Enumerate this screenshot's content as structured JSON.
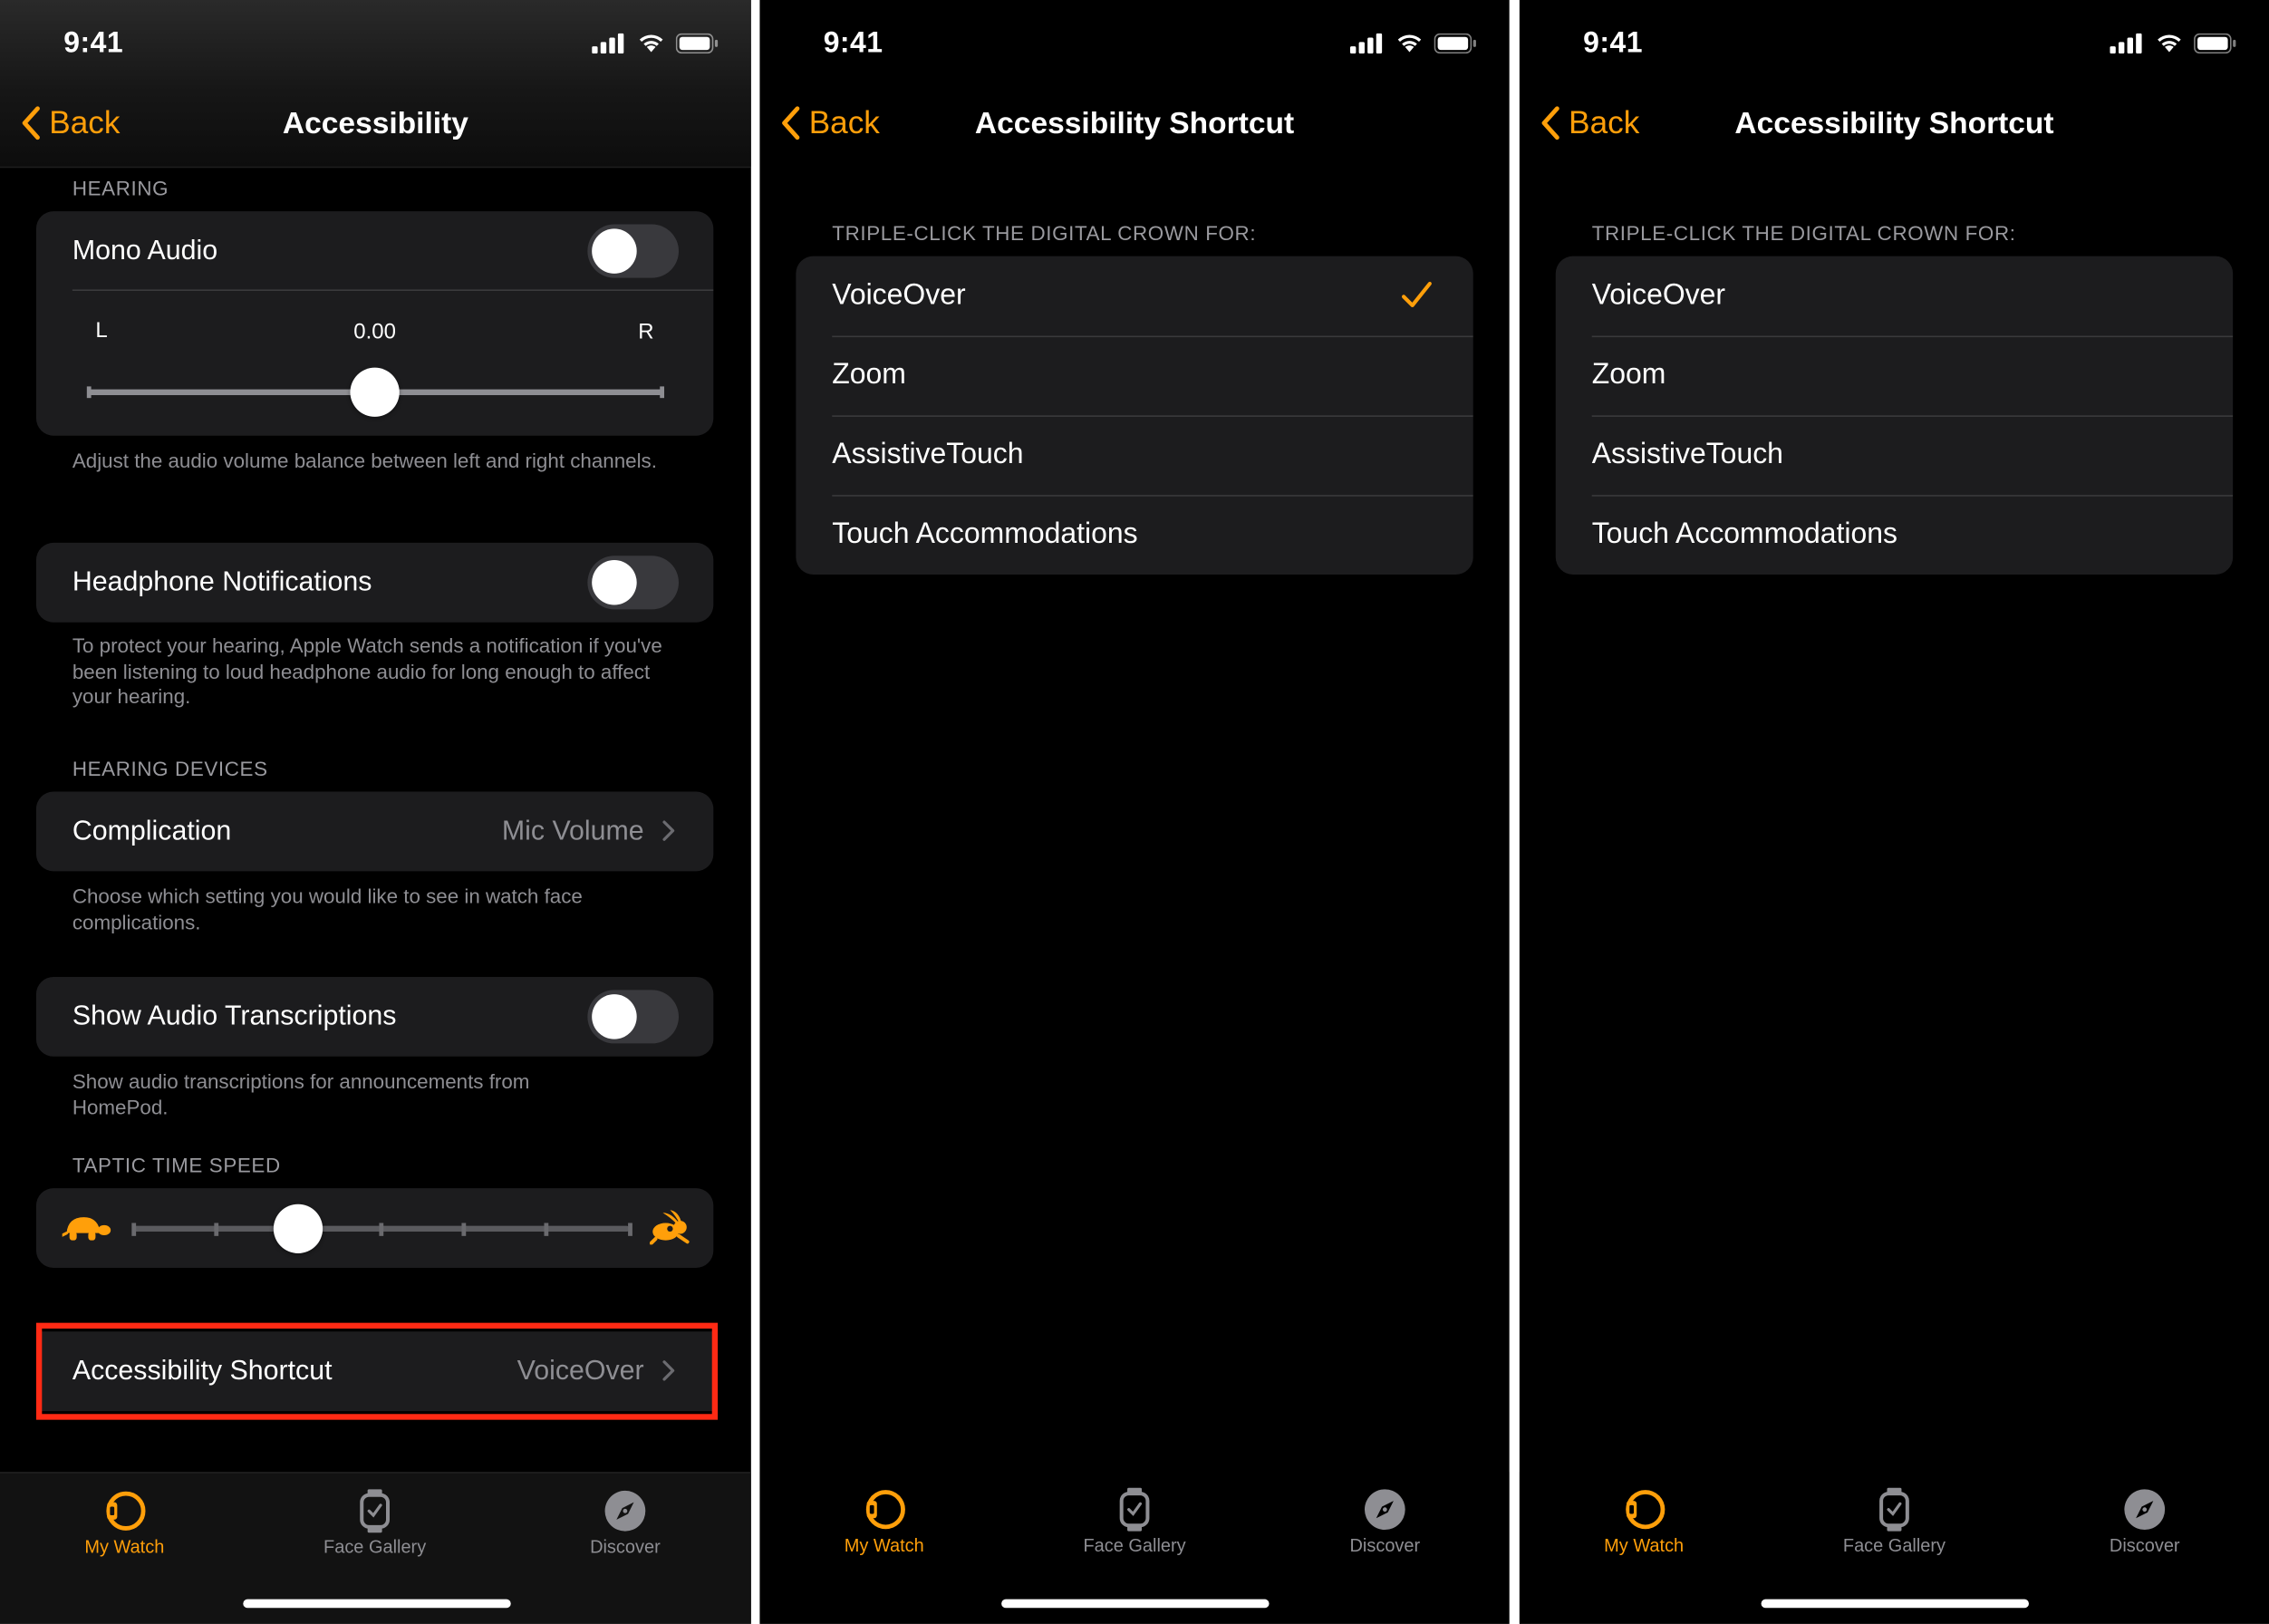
{
  "status": {
    "time": "9:41"
  },
  "colors": {
    "accent": "#ff9f0a",
    "highlight": "#ff2a14",
    "cell": "#1c1c1e"
  },
  "screen1": {
    "back_label": "Back",
    "title": "Accessibility",
    "hearing_header": "HEARING",
    "mono_audio_label": "Mono Audio",
    "mono_audio_on": false,
    "balance_left": "L",
    "balance_right": "R",
    "balance_value": "0.00",
    "balance_footer": "Adjust the audio volume balance between left and right channels.",
    "headphone_label": "Headphone Notifications",
    "headphone_on": false,
    "headphone_footer": "To protect your hearing, Apple Watch sends a notification if you've been listening to loud headphone audio for long enough to affect your hearing.",
    "hearing_devices_header": "HEARING DEVICES",
    "complication_label": "Complication",
    "complication_value": "Mic Volume",
    "complication_footer": "Choose which setting you would like to see in watch face complications.",
    "transcriptions_label": "Show Audio Transcriptions",
    "transcriptions_on": false,
    "transcriptions_footer": "Show audio transcriptions for announcements from HomePod.",
    "taptic_header": "TAPTIC TIME SPEED",
    "taptic_level": 2,
    "taptic_steps": 7,
    "shortcut_label": "Accessibility Shortcut",
    "shortcut_value": "VoiceOver"
  },
  "screen2": {
    "back_label": "Back",
    "title": "Accessibility Shortcut",
    "header": "TRIPLE-CLICK THE DIGITAL CROWN FOR:",
    "options": [
      "VoiceOver",
      "Zoom",
      "AssistiveTouch",
      "Touch Accommodations"
    ],
    "selected": "VoiceOver"
  },
  "screen3": {
    "back_label": "Back",
    "title": "Accessibility Shortcut",
    "header": "TRIPLE-CLICK THE DIGITAL CROWN FOR:",
    "options": [
      "VoiceOver",
      "Zoom",
      "AssistiveTouch",
      "Touch Accommodations"
    ],
    "selected": ""
  },
  "tabbar": {
    "tabs": [
      {
        "label": "My Watch",
        "icon": "watch-ring-icon",
        "active": true
      },
      {
        "label": "Face Gallery",
        "icon": "watch-face-icon",
        "active": false
      },
      {
        "label": "Discover",
        "icon": "compass-icon",
        "active": false
      }
    ]
  }
}
